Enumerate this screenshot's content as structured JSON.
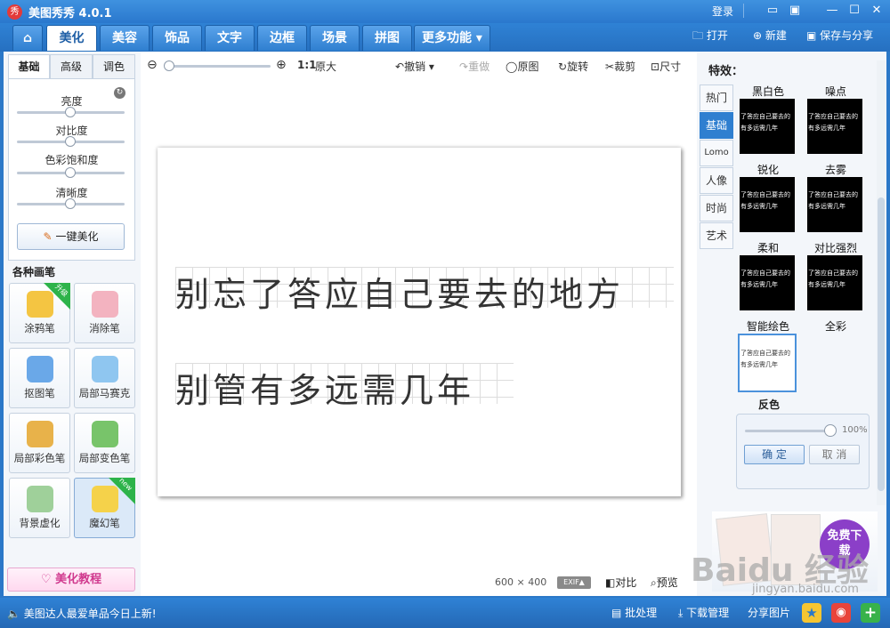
{
  "app": {
    "title": "美图秀秀 4.0.1",
    "logo_char": "秀",
    "login": "登录"
  },
  "tabs": [
    "美化",
    "美容",
    "饰品",
    "文字",
    "边框",
    "场景",
    "拼图",
    "更多功能"
  ],
  "top_actions": {
    "open": "打开",
    "new": "新建",
    "save": "保存与分享"
  },
  "left": {
    "subtabs": [
      "基础",
      "高级",
      "调色"
    ],
    "sliders": [
      {
        "label": "亮度",
        "value": 0.5
      },
      {
        "label": "对比度",
        "value": 0.5
      },
      {
        "label": "色彩饱和度",
        "value": 0.5
      },
      {
        "label": "清晰度",
        "value": 0.5
      }
    ],
    "one_click": "一键美化",
    "brushes_title": "各种画笔",
    "tools": [
      {
        "label": "涂鸦笔",
        "badge": "升级"
      },
      {
        "label": "消除笔",
        "badge": ""
      },
      {
        "label": "抠图笔",
        "badge": ""
      },
      {
        "label": "局部马赛克",
        "badge": ""
      },
      {
        "label": "局部彩色笔",
        "badge": ""
      },
      {
        "label": "局部变色笔",
        "badge": ""
      },
      {
        "label": "背景虚化",
        "badge": ""
      },
      {
        "label": "魔幻笔",
        "badge": "new"
      }
    ],
    "tutorial": "美化教程"
  },
  "toolbar": {
    "zoom_ratio": "1:1",
    "original_size": "原大",
    "undo": "撤销",
    "redo": "重做",
    "original": "原图",
    "rotate": "旋转",
    "crop": "裁剪",
    "resize": "尺寸"
  },
  "canvas": {
    "line1": "别忘了答应自己要去的地方",
    "line2": "别管有多远需几年",
    "width": "600",
    "times": "×",
    "height": "400",
    "exif": "EXIF▲",
    "compare": "对比",
    "preview": "预览"
  },
  "right": {
    "title": "特效：",
    "categories": [
      "热门",
      "基础",
      "Lomo",
      "人像",
      "时尚",
      "艺术"
    ],
    "effects": [
      {
        "label": "黑白色"
      },
      {
        "label": "噪点"
      },
      {
        "label": "锐化"
      },
      {
        "label": "去雾"
      },
      {
        "label": "柔和"
      },
      {
        "label": "对比强烈"
      },
      {
        "label": "智能绘色"
      },
      {
        "label": "全彩"
      }
    ],
    "thumb_text": "了答应自己要去的 有多远需几年",
    "selected_effect": "反色",
    "strength": "100%",
    "ok": "确 定",
    "cancel": "取 消",
    "ad": "免费下载",
    "watermark": "Baidu 经验",
    "watermark_url": "jingyan.baidu.com"
  },
  "status": {
    "message": "美图达人最爱单品今日上新!",
    "batch": "批处理",
    "download": "下载管理",
    "share": "分享图片"
  }
}
